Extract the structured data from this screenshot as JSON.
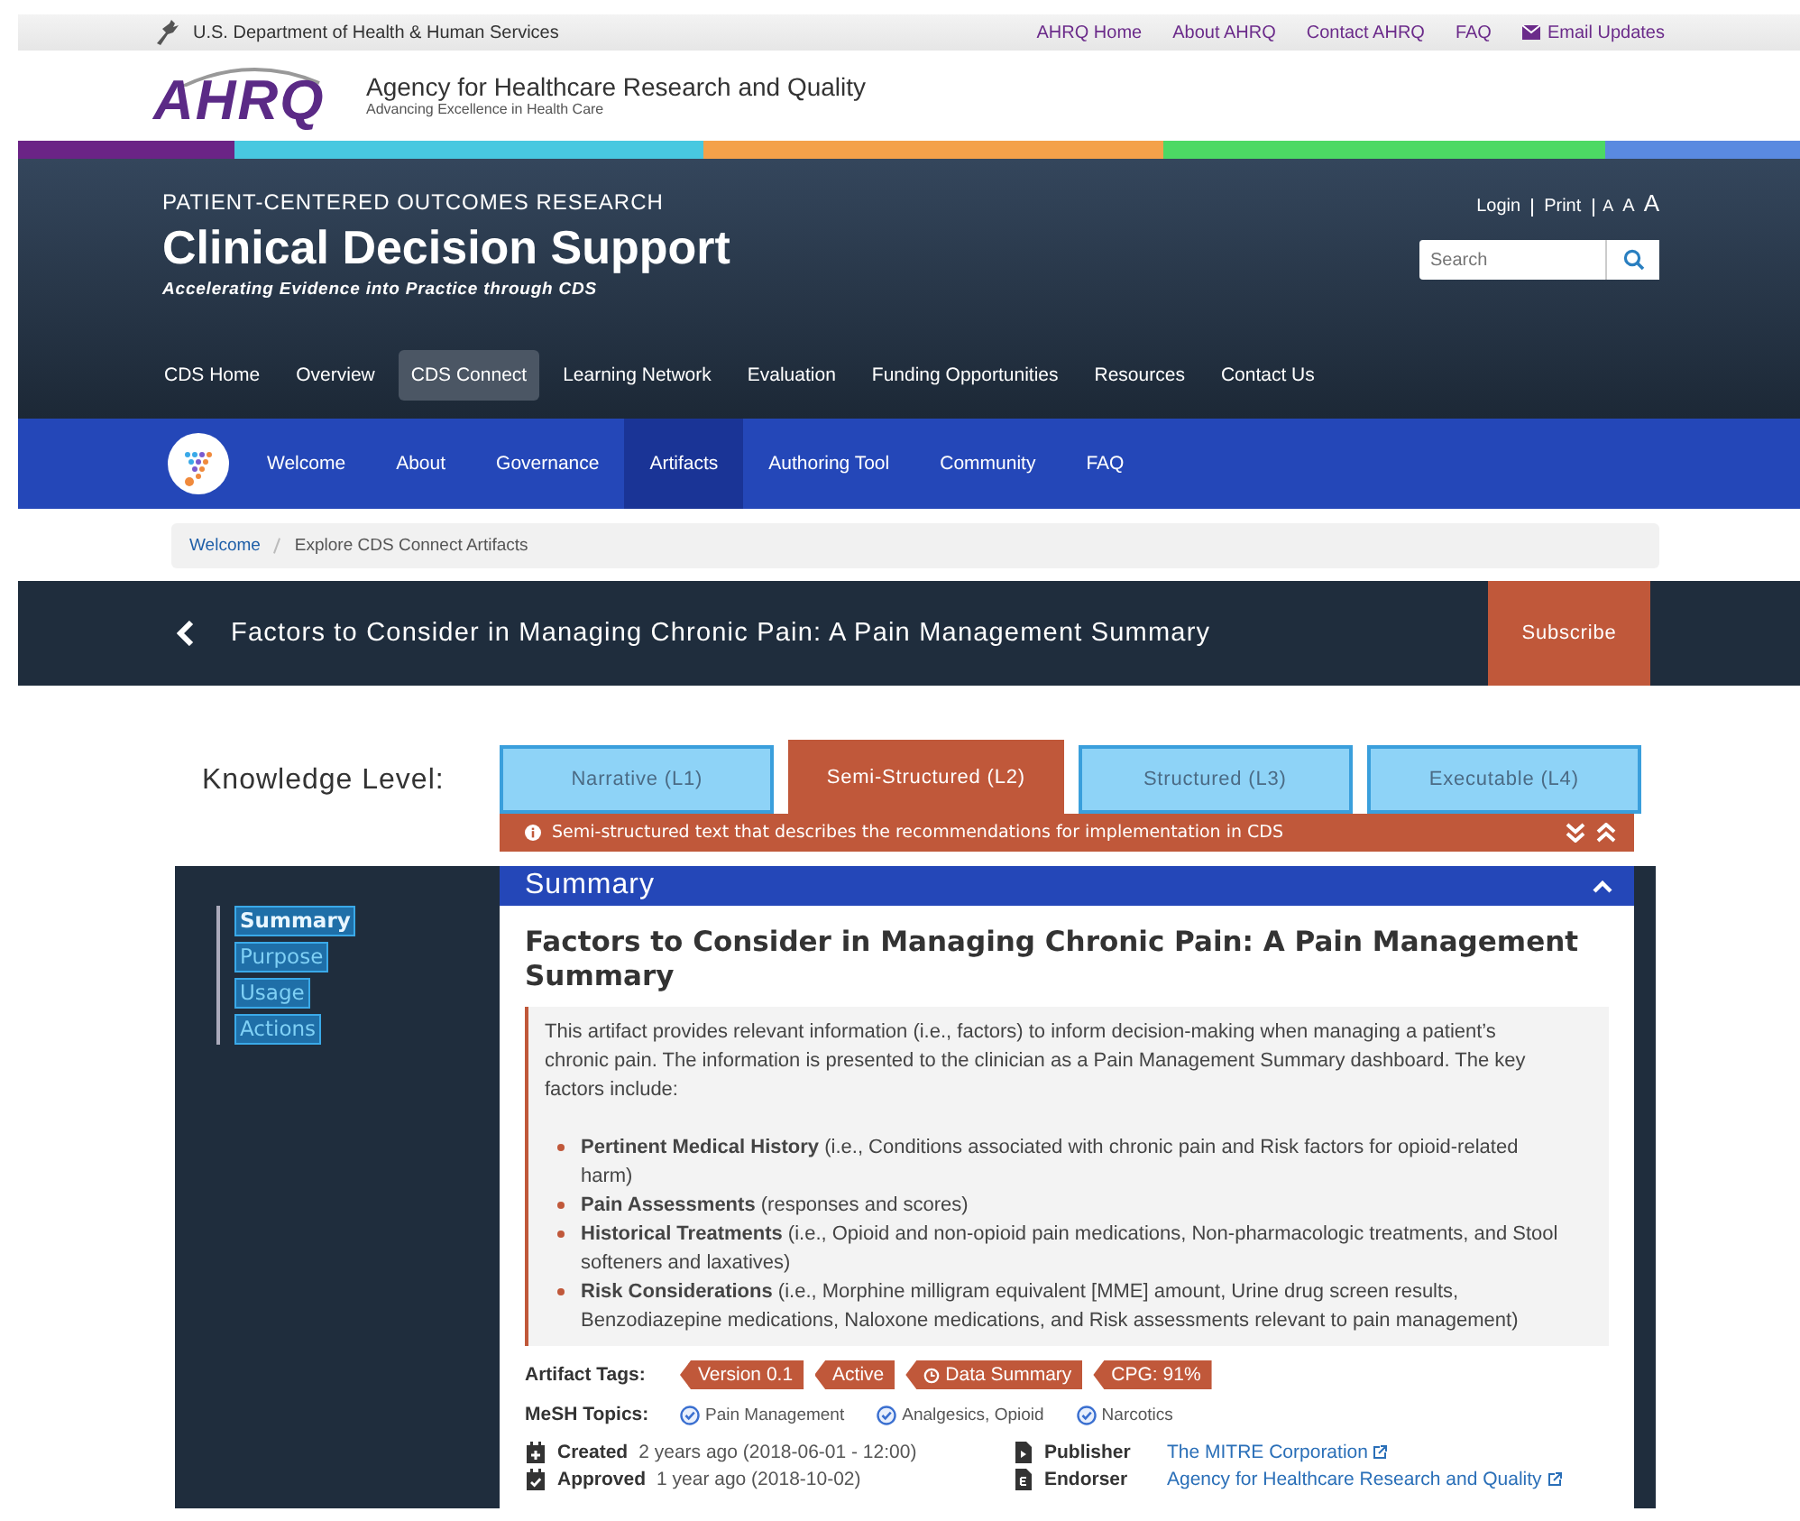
{
  "top_bar": {
    "agency": "U.S. Department of Health & Human Services",
    "links": [
      {
        "label": "AHRQ Home",
        "kind": "plain"
      },
      {
        "label": "About AHRQ",
        "kind": "plain"
      },
      {
        "label": "Contact AHRQ",
        "kind": "plain"
      },
      {
        "label": "FAQ",
        "kind": "plain"
      },
      {
        "label": "Email Updates",
        "kind": "email"
      }
    ]
  },
  "logo": {
    "mark": "AHRQ",
    "name": "Agency for Healthcare Research and Quality",
    "tagline": "Advancing Excellence in Health Care"
  },
  "header": {
    "eyebrow": "PATIENT-CENTERED OUTCOMES RESEARCH",
    "title": "Clinical Decision Support",
    "subtitle": "Accelerating Evidence into Practice through CDS",
    "utility_links": [
      "Login",
      "Print"
    ],
    "font_sizes": [
      {
        "label": "A",
        "kind": "small"
      },
      {
        "label": "A",
        "kind": "medium"
      },
      {
        "label": "A",
        "kind": "large"
      }
    ],
    "search": {
      "placeholder": "Search"
    }
  },
  "main_nav": [
    {
      "label": "CDS Home",
      "selected": false
    },
    {
      "label": "Overview",
      "selected": false
    },
    {
      "label": "CDS Connect",
      "selected": true
    },
    {
      "label": "Learning Network",
      "selected": false
    },
    {
      "label": "Evaluation",
      "selected": false
    },
    {
      "label": "Funding Opportunities",
      "selected": false
    },
    {
      "label": "Resources",
      "selected": false
    },
    {
      "label": "Contact Us",
      "selected": false
    }
  ],
  "sub_nav": [
    {
      "label": "Welcome",
      "selected": false
    },
    {
      "label": "About",
      "selected": false
    },
    {
      "label": "Governance",
      "selected": false
    },
    {
      "label": "Artifacts",
      "selected": true
    },
    {
      "label": "Authoring Tool",
      "selected": false
    },
    {
      "label": "Community",
      "selected": false
    },
    {
      "label": "FAQ",
      "selected": false
    }
  ],
  "breadcrumb": [
    {
      "label": "Welcome",
      "kind": "link"
    },
    {
      "label": "Explore CDS Connect Artifacts",
      "kind": "current"
    }
  ],
  "artifact_bar": {
    "title": "Factors to Consider in Managing Chronic Pain: A Pain Management Summary",
    "subscribe": "Subscribe"
  },
  "knowledge_level": {
    "label": "Knowledge Level:",
    "tabs": [
      {
        "label": "Narrative (L1)",
        "selected": false
      },
      {
        "label": "Semi-Structured (L2)",
        "selected": true
      },
      {
        "label": "Structured (L3)",
        "selected": false
      },
      {
        "label": "Executable (L4)",
        "selected": false
      }
    ],
    "info": "Semi-structured text that describes the recommendations for implementation in CDS"
  },
  "sidebar": [
    {
      "label": "Summary",
      "selected": true
    },
    {
      "label": "Purpose",
      "selected": false
    },
    {
      "label": "Usage",
      "selected": false
    },
    {
      "label": "Actions",
      "selected": false
    }
  ],
  "summary": {
    "heading": "Summary",
    "title": "Factors to Consider in Managing Chronic Pain: A Pain Management Summary",
    "intro": "This artifact provides relevant information (i.e., factors) to inform decision-making when managing a patient’s chronic pain. The information is presented to the clinician as a Pain Management Summary dashboard. The key factors include:",
    "factors": [
      "**Pertinent Medical History** (i.e., Conditions associated with chronic pain and Risk factors for opioid-related harm)",
      "**Pain Assessments** (responses and scores)",
      "**Historical Treatments** (i.e., Opioid and non-opioid pain medications, Non-pharmacologic treatments, and Stool softeners and laxatives)",
      "**Risk Considerations** (i.e., Morphine milligram equivalent [MME] amount, Urine drug screen results, Benzodiazepine medications, Naloxone medications, and Risk assessments relevant to pain management)"
    ],
    "tags_label": "Artifact Tags:",
    "tags": [
      {
        "label": "Version 0.1",
        "kind": "plain"
      },
      {
        "label": "Active",
        "kind": "plain"
      },
      {
        "label": "Data Summary",
        "kind": "clock"
      },
      {
        "label": "CPG: 91%",
        "kind": "plain"
      }
    ],
    "mesh_label": "MeSH Topics:",
    "mesh": [
      "Pain Management",
      "Analgesics, Opioid",
      "Narcotics"
    ],
    "meta": [
      {
        "kind": "created",
        "label": "Created",
        "text": "2 years ago (2018-06-01 - 12:00)"
      },
      {
        "kind": "publisher",
        "label": "Publisher",
        "link": "The MITRE Corporation"
      },
      {
        "kind": "approved",
        "label": "Approved",
        "text": "1 year ago (2018-10-02)"
      },
      {
        "kind": "endorser",
        "label": "Endorser",
        "link": "Agency for Healthcare Research and Quality"
      }
    ]
  }
}
